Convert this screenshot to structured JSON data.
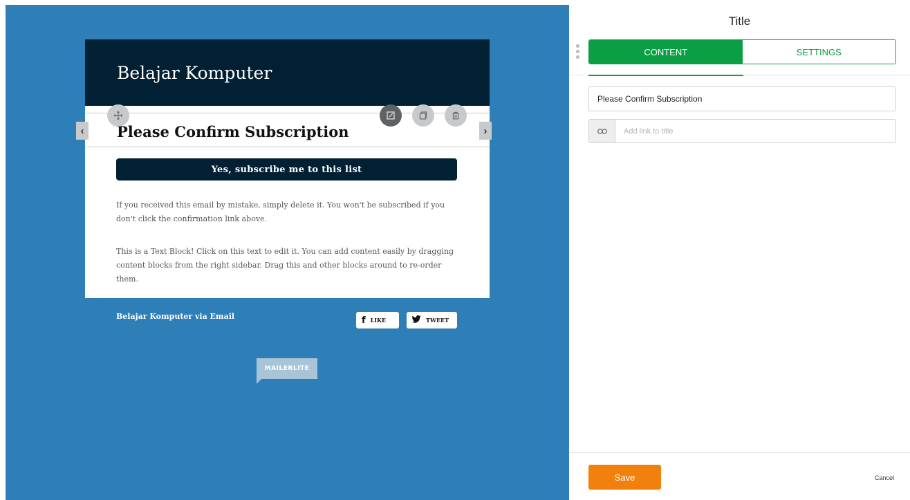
{
  "email": {
    "brand": "Belajar Komputer",
    "title": "Please Confirm Subscription",
    "cta_label": "Yes, subscribe me to this list",
    "paragraph1": "If you received this email by mistake, simply delete it. You won't be subscribed if you don't click the confirmation link above.",
    "paragraph2": "This is a Text Block! Click on this text to edit it. You can add content easily by dragging content blocks from the right sidebar. Drag this and other blocks around to re-order them.",
    "footer_text": "Belajar Komputer via Email",
    "like_label": "LIKE",
    "tweet_label": "TWEET",
    "badge": "MAILERLITE"
  },
  "controls": {
    "move_icon": "move-icon",
    "edit_icon": "edit-icon",
    "duplicate_icon": "duplicate-icon",
    "delete_icon": "trash-icon",
    "prev_glyph": "‹",
    "next_glyph": "›"
  },
  "panel": {
    "title": "Title",
    "tabs": [
      {
        "label": "CONTENT",
        "active": true
      },
      {
        "label": "SETTINGS",
        "active": false
      }
    ],
    "title_value": "Please Confirm Subscription",
    "link_placeholder": "Add link to title",
    "link_icon": "link-icon",
    "save_label": "Save",
    "cancel_label": "Cancel"
  },
  "colors": {
    "canvas_bg": "#2e7eb8",
    "header_bg": "#012033",
    "accent_green": "#0b9f45",
    "save_orange": "#f2800d"
  }
}
